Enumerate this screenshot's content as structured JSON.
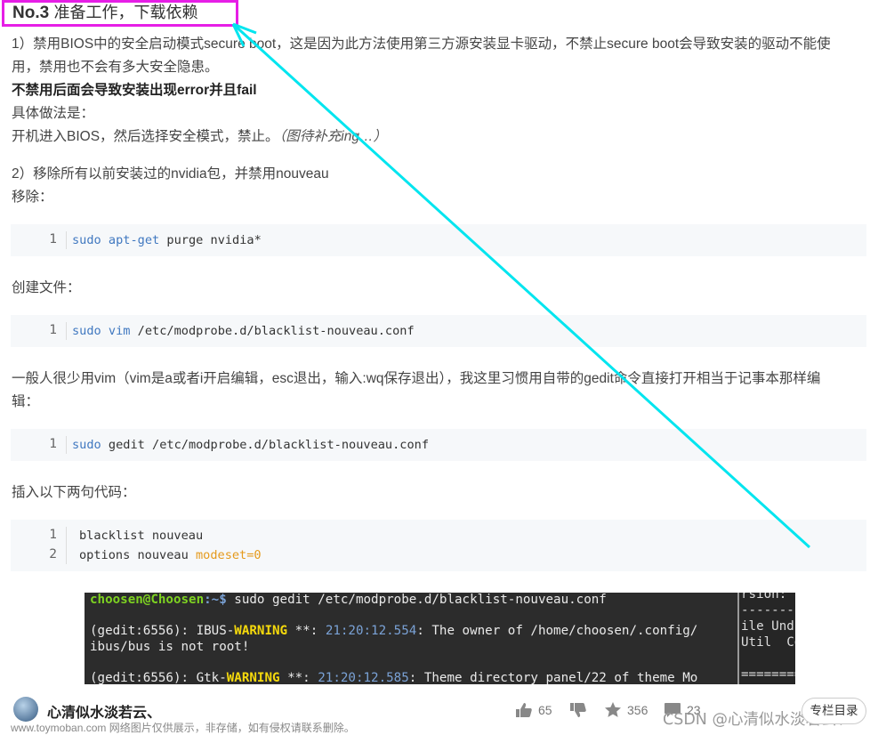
{
  "heading": {
    "num": "No.3",
    "text": "准备工作，下载依赖"
  },
  "para1": "1）禁用BIOS中的安全启动模式secure boot，这是因为此方法使用第三方源安装显卡驱动，不禁止secure boot会导致安装的驱动不能使",
  "para1b": "用，禁用也不会有多大安全隐患。",
  "para2": "不禁用后面会导致安装出现error并且fail",
  "para3": "具体做法是：",
  "para4": "开机进入BIOS，然后选择安全模式，禁止。",
  "para4i": "（图待补充ing…）",
  "para5": "2）移除所有以前安装过的nvidia包，并禁用nouveau",
  "para6": "移除：",
  "code1": {
    "ln": "1",
    "kw": "sudo apt-get",
    "rest": " purge nvidia*"
  },
  "para7": "创建文件：",
  "code2": {
    "ln": "1",
    "kw": "sudo vim",
    "rest": " /etc/modprobe.d/blacklist-nouveau.conf"
  },
  "para8": "一般人很少用vim（vim是a或者i开启编辑，esc退出，输入:wq保存退出），我这里习惯用自带的gedit命令直接打开相当于记事本那样编",
  "para8b": "辑：",
  "code3": {
    "ln": "1",
    "kw": "sudo",
    "rest": " gedit /etc/modprobe.d/blacklist-nouveau.conf"
  },
  "para9": "插入以下两句代码：",
  "code4": {
    "ln1": "1",
    "ln2": "2",
    "line1": "blacklist nouveau",
    "line2a": "options nouveau ",
    "line2b": "modeset=0"
  },
  "terminal": {
    "prompt_user": "choosen@Choosen",
    "prompt_path": ":~$",
    "cmd": " sudo gedit /etc/modprobe.d/blacklist-nouveau.conf",
    "l2a": "(gedit:6556): IBUS-",
    "l2w": "WARNING",
    "l2b": " **: ",
    "l2t": "21:20:12.554",
    "l2c": ": The owner of /home/choosen/.config/",
    "l3": "ibus/bus is not root!",
    "l4a": "(gedit:6556): Gtk-",
    "l4w": "WARNING",
    "l4b": " **: ",
    "l4t": "21:20:12.585",
    "l4c": ": Theme directory panel/22 of theme Mo",
    "side1": "rsion:",
    "side2": "-------",
    "side3": "ile Und",
    "side4": "Util  Co",
    "side5": "========"
  },
  "bottom": {
    "author": "心清似水淡若云、",
    "likes": "65",
    "favs": "356",
    "comments": "23",
    "toc": "专栏目录",
    "watermark": "www.toymoban.com 网络图片仅供展示，非存储，如有侵权请联系删除。",
    "csdn": "CSDN @心清似水淡若云、"
  },
  "colors": {
    "highlight_box": "#e61ee6",
    "arrow": "#00e5ef",
    "code_bg": "#f6f8fa",
    "keyword": "#4078c0"
  }
}
